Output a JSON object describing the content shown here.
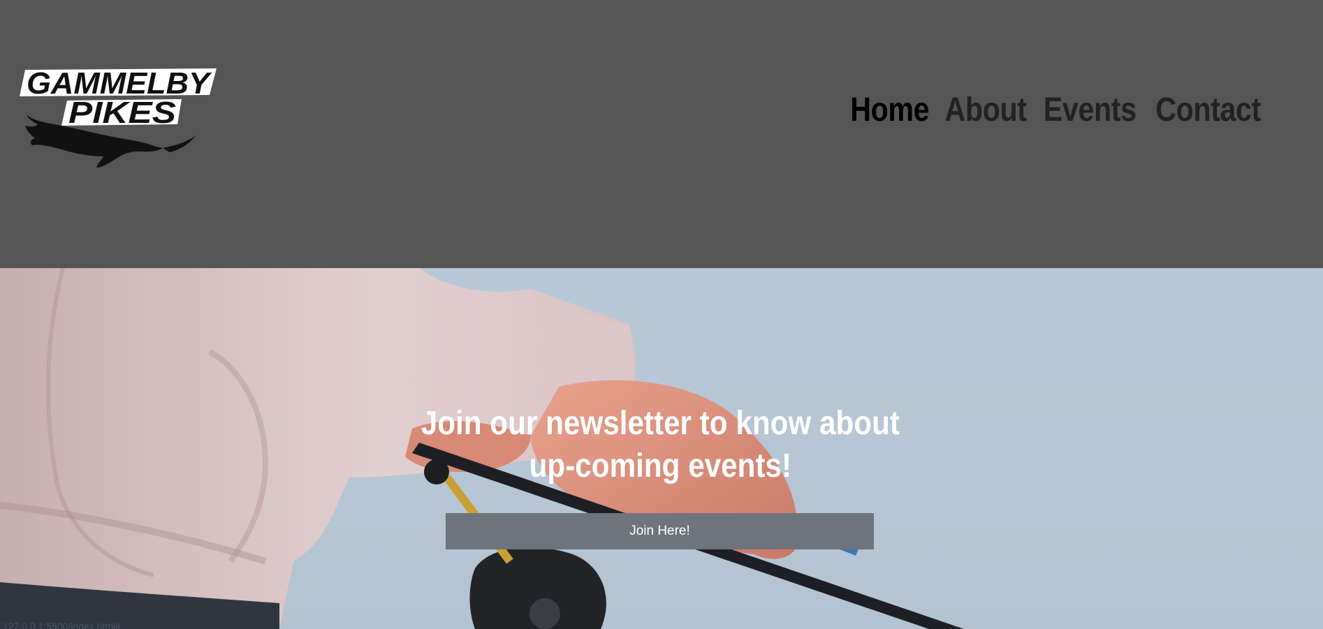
{
  "brand": {
    "line1": "GAMMELBY",
    "line2": "PIKES"
  },
  "nav": {
    "items": [
      {
        "label": "Home",
        "active": true
      },
      {
        "label": "About",
        "active": false
      },
      {
        "label": "Events",
        "active": false
      },
      {
        "label": "Contact",
        "active": false
      }
    ]
  },
  "hero": {
    "title_line1": "Join our newsletter to know about",
    "title_line2": "up-coming events!",
    "button_label": "Join Here!"
  },
  "status_bar": {
    "url": "127.0.0.1:5500/index.html#"
  },
  "colors": {
    "header_bg": "#565556",
    "nav_text": "#222124",
    "nav_active": "#000000",
    "button_bg": "#6d747b",
    "hero_text": "#ffffff"
  }
}
